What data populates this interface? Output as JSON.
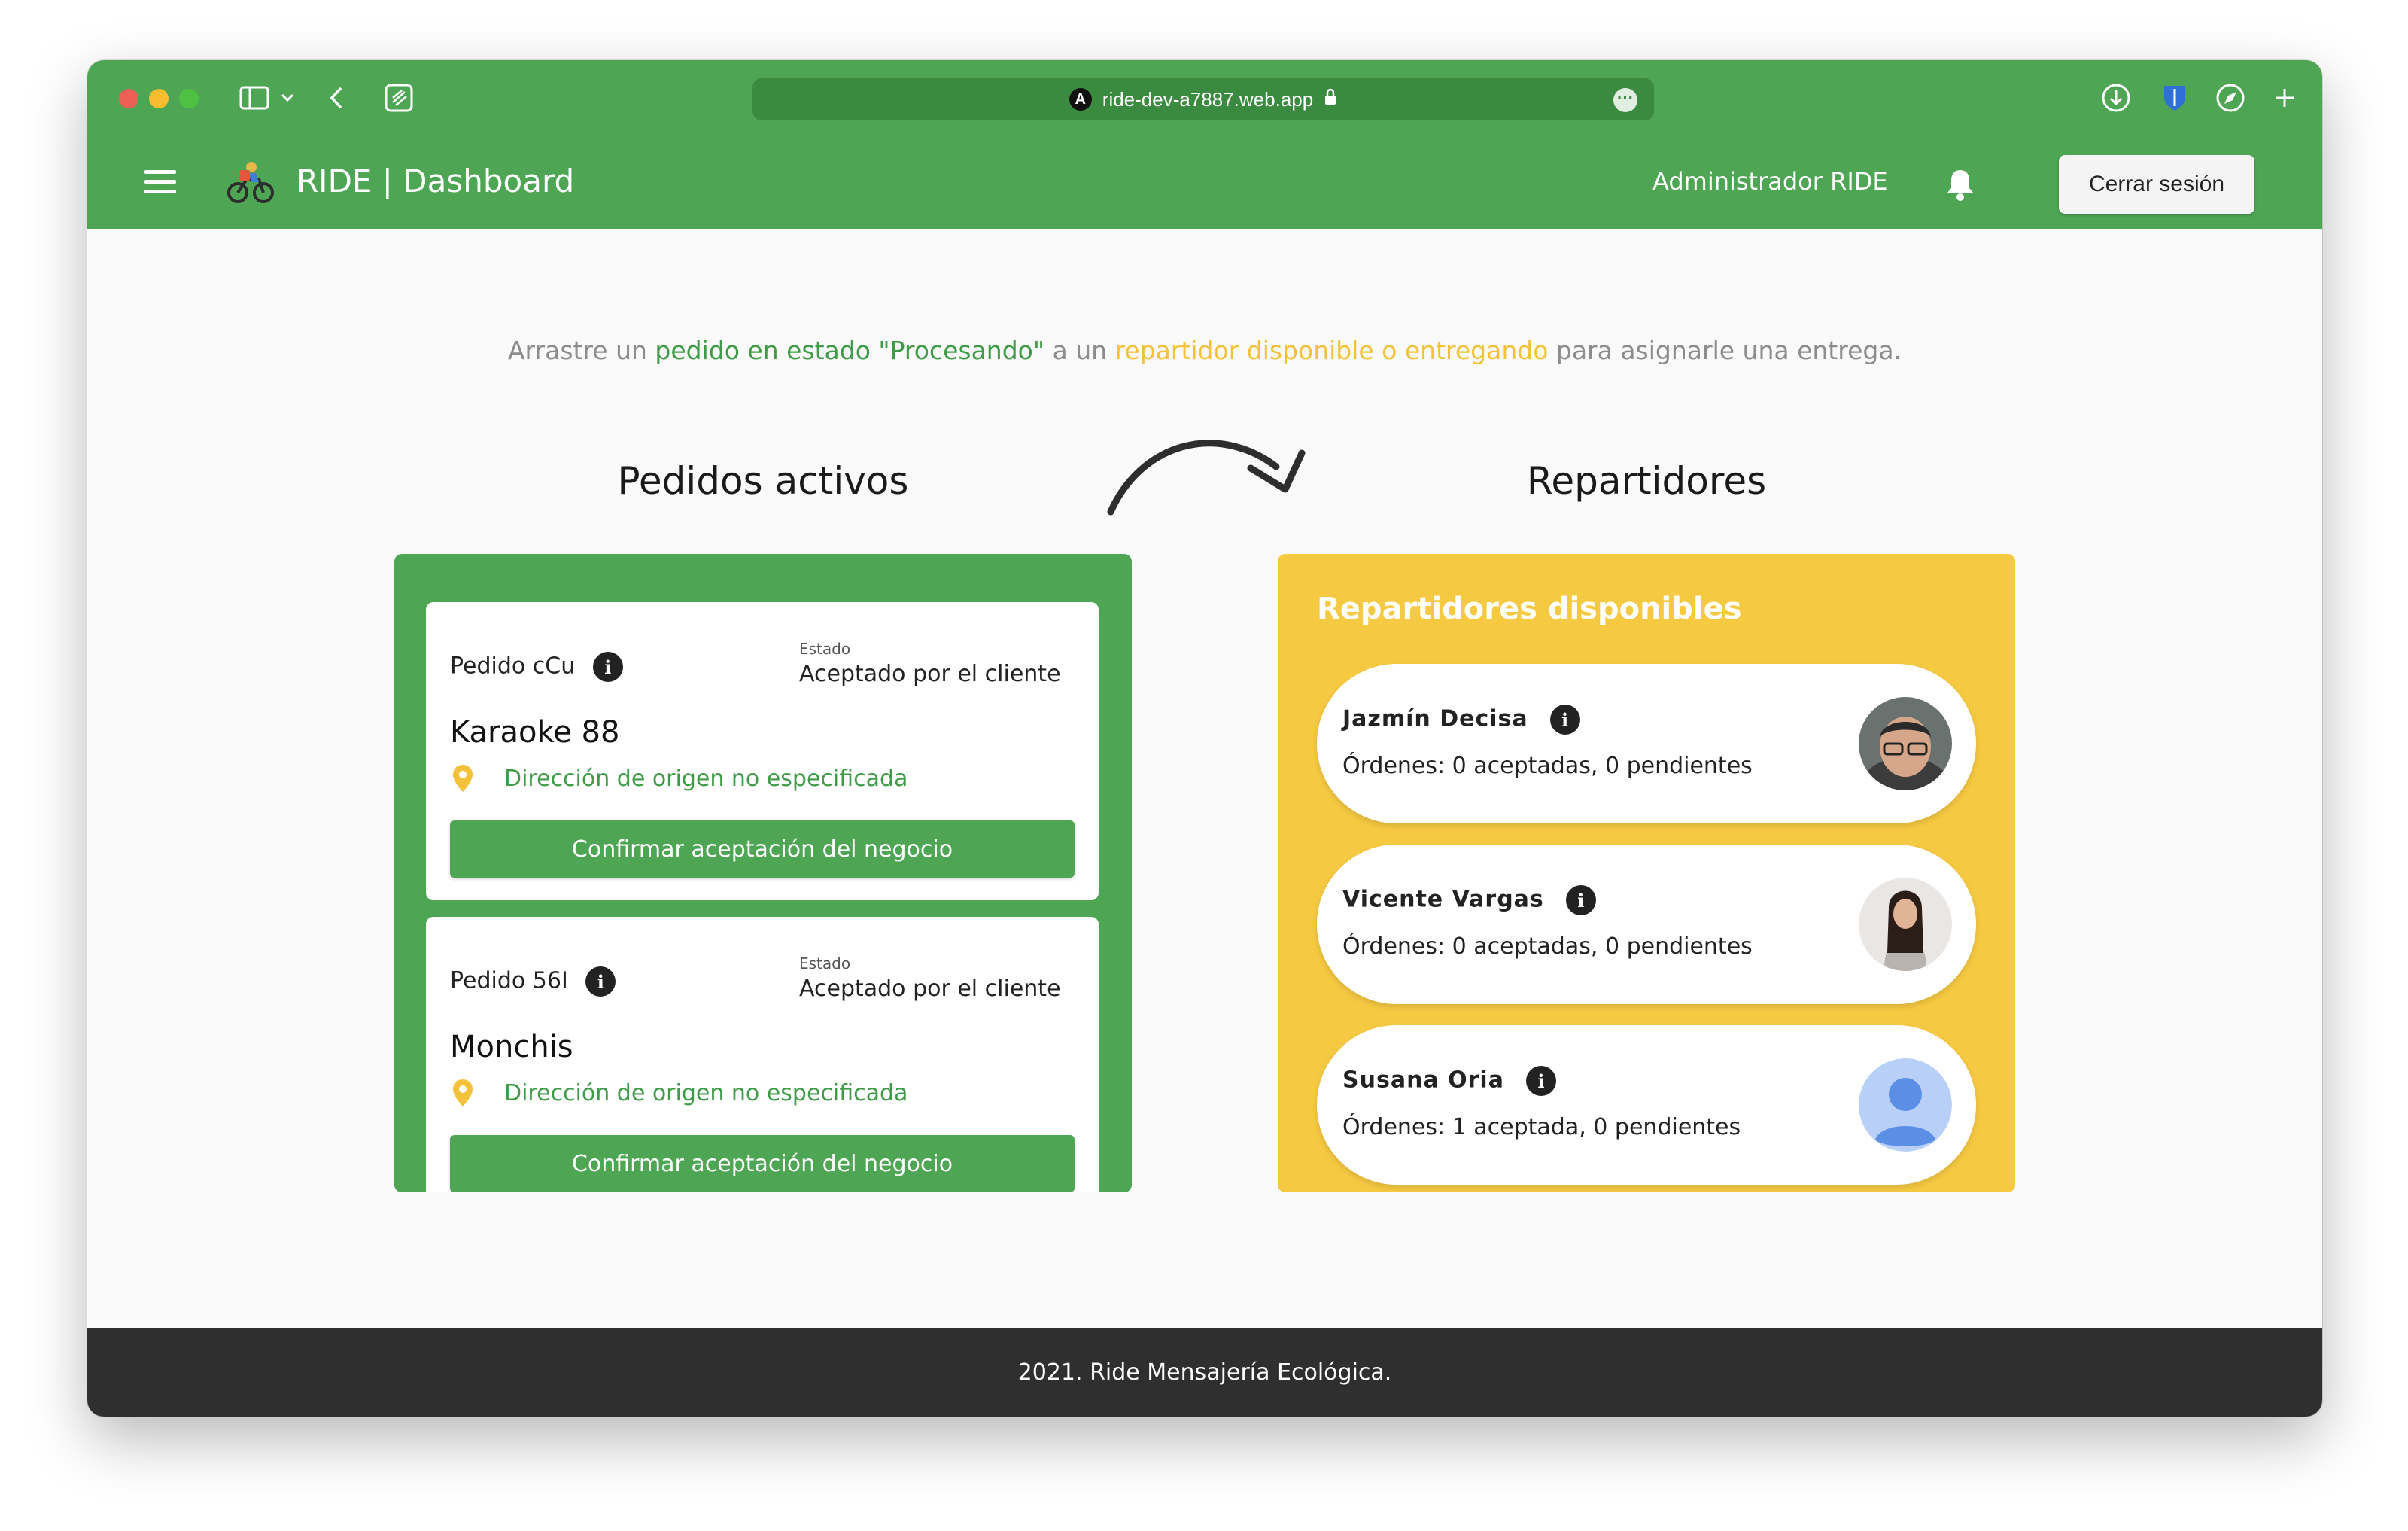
{
  "browser": {
    "url": "ride-dev-a7887.web.app",
    "site_icon_letter": "A"
  },
  "header": {
    "title": "RIDE | Dashboard",
    "admin_name": "Administrador RIDE",
    "logout_label": "Cerrar sesión"
  },
  "instruction": {
    "part1": "Arrastre un ",
    "part2": "pedido en estado \"Procesando\"",
    "part3": " a un ",
    "part4": "repartidor disponible o entregando",
    "part5": " para asignarle una entrega."
  },
  "orders": {
    "title": "Pedidos activos",
    "items": [
      {
        "id": "Pedido cCu",
        "estado_label": "Estado",
        "estado": "Aceptado por el cliente",
        "business": "Karaoke 88",
        "address": "Dirección de origen no especificada",
        "button": "Confirmar aceptación del negocio"
      },
      {
        "id": "Pedido 56I",
        "estado_label": "Estado",
        "estado": "Aceptado por el cliente",
        "business": "Monchis",
        "address": "Dirección de origen no especificada",
        "button": "Confirmar aceptación del negocio"
      }
    ]
  },
  "riders": {
    "title": "Repartidores",
    "panel_title": "Repartidores disponibles",
    "items": [
      {
        "name": "Jazmín Decisa",
        "orders": "Órdenes: 0 aceptadas, 0 pendientes",
        "avatar": "photo-man-glasses"
      },
      {
        "name": "Vicente Vargas",
        "orders": "Órdenes: 0 aceptadas, 0 pendientes",
        "avatar": "photo-woman"
      },
      {
        "name": "Susana Oria",
        "orders": "Órdenes: 1 aceptada, 0 pendientes",
        "avatar": "default-user-avatar"
      }
    ]
  },
  "footer": {
    "text": "2021. Ride Mensajería Ecológica."
  },
  "colors": {
    "primary_green": "#4ea655",
    "accent_yellow": "#f6c942",
    "footer_dark": "#2f2f2f"
  }
}
